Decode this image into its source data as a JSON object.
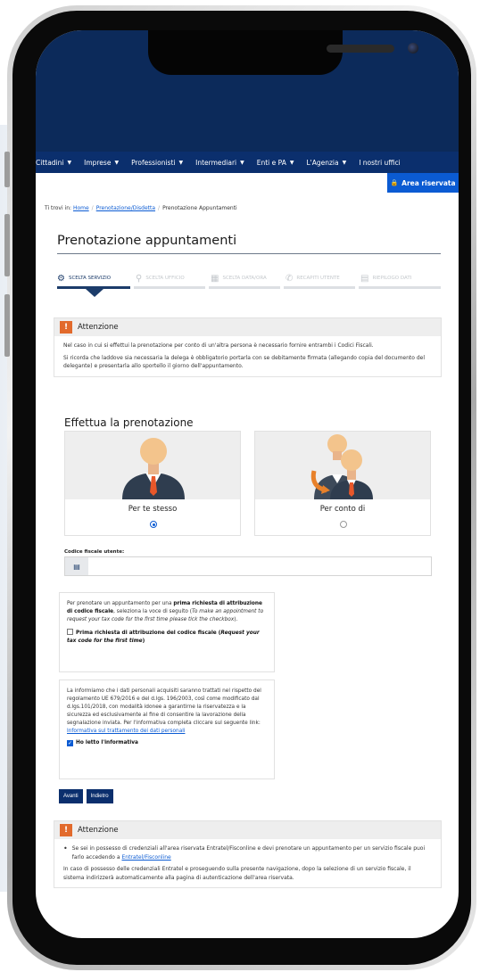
{
  "nav": {
    "items": [
      {
        "label": "Cittadini",
        "caret": true
      },
      {
        "label": "Imprese",
        "caret": true
      },
      {
        "label": "Professionisti",
        "caret": true
      },
      {
        "label": "Intermediari",
        "caret": true
      },
      {
        "label": "Enti e PA",
        "caret": true
      },
      {
        "label": "L'Agenzia",
        "caret": true
      },
      {
        "label": "I nostri uffici",
        "caret": false
      }
    ],
    "area_riservata": "Area riservata"
  },
  "breadcrumb": {
    "prefix": "Ti trovi in:",
    "home": "Home",
    "parent": "Prenotazione/Disdetta",
    "current": "Prenotazione Appuntamenti"
  },
  "page": {
    "title": "Prenotazione appuntamenti"
  },
  "steps": [
    {
      "label": "Scelta servizio",
      "icon": "gears-icon",
      "active": true
    },
    {
      "label": "Scelta ufficio",
      "icon": "map-pin-icon",
      "active": false
    },
    {
      "label": "Scelta data/ora",
      "icon": "calendar-icon",
      "active": false
    },
    {
      "label": "Recapiti utente",
      "icon": "phone-icon",
      "active": false
    },
    {
      "label": "Riepilogo dati",
      "icon": "id-card-icon",
      "active": false
    }
  ],
  "attention1": {
    "title": "Attenzione",
    "p1": "Nel caso in cui si effettui la prenotazione per conto di un'altra persona è necessario fornire entrambi i Codici Fiscali.",
    "p2": "Si ricorda che laddove sia necessaria la delega è obbligatorio portarla con se debitamente firmata (allegando copia del documento del delegante) e presentarla allo sportello il giorno dell'appuntamento."
  },
  "booking": {
    "title": "Effettua la prenotazione",
    "option_self": "Per te stesso",
    "option_other": "Per conto di",
    "selected": "self"
  },
  "codice_fiscale": {
    "label": "Codice fiscale utente:",
    "value": ""
  },
  "first_request": {
    "text_a": "Per prenotare un appuntamento per una ",
    "text_bold": "prima richiesta di attribuzione di codice fiscale",
    "text_b": ", seleziona la voce di seguito (",
    "text_italic": "To make an appointment to request your tax code for the first time please tick the checkbox",
    "text_c": ").",
    "checkbox_label": "Prima richiesta di attribuzione del codice fiscale (",
    "checkbox_label_italic": "Request your tax code for the first time",
    "checkbox_label_end": ")",
    "checked": false
  },
  "privacy": {
    "text": "La informiamo che i dati personali acquisiti saranno trattati nel rispetto del regolamento UE 679/2016 e del d.lgs. 196/2003, così come modificato dal d.lgs.101/2018, con modalità idonee a garantirne la riservatezza e la sicurezza ed esclusivamente al fine di consentire la lavorazione della segnalazione inviata. Per l'informativa completa cliccare sul seguente link:",
    "link": "Informativa sul trattamento dei dati personali",
    "checkbox_label": "Ho letto l'informativa",
    "checked": true
  },
  "buttons": {
    "next": "Avanti",
    "back": "Indietro"
  },
  "attention2": {
    "title": "Attenzione",
    "bullet_a": "Se sei in possesso di credenziali all'area riservata Entratel/Fisconline e devi prenotare un appuntamento per un servizio fiscale puoi farlo accedendo a ",
    "bullet_link": "Entratel/Fisconline",
    "p2": "In caso di possesso delle credenziali Entratel e proseguendo sulla presente navigazione, dopo la selezione di un servizio fiscale, il sistema indirizzerà automaticamente alla pagina di autenticazione dell'area riservata."
  },
  "colors": {
    "nav": "#0b2f6d",
    "header_dark": "#0c2a5a",
    "accent": "#0b5bd3",
    "warning": "#e26a2c"
  }
}
